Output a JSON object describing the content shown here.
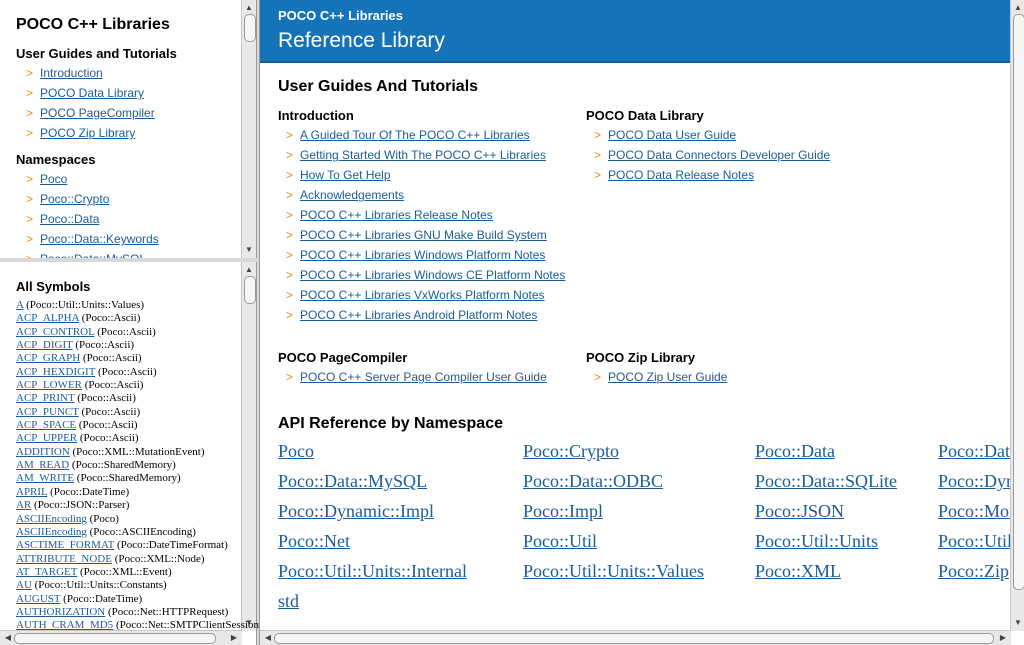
{
  "top_left": {
    "title": "POCO C++ Libraries",
    "guides_heading": "User Guides and Tutorials",
    "guides": [
      "Introduction",
      "POCO Data Library",
      "POCO PageCompiler",
      "POCO Zip Library"
    ],
    "namespaces_heading": "Namespaces",
    "namespaces": [
      "Poco",
      "Poco::Crypto",
      "Poco::Data",
      "Poco::Data::Keywords",
      "Poco::Data::MySQL"
    ]
  },
  "bottom_left": {
    "heading": "All Symbols",
    "symbols": [
      {
        "name": "A",
        "scope": "(Poco::Util::Units::Values)"
      },
      {
        "name": "ACP_ALPHA",
        "scope": "(Poco::Ascii)"
      },
      {
        "name": "ACP_CONTROL",
        "scope": "(Poco::Ascii)"
      },
      {
        "name": "ACP_DIGIT",
        "scope": "(Poco::Ascii)"
      },
      {
        "name": "ACP_GRAPH",
        "scope": "(Poco::Ascii)"
      },
      {
        "name": "ACP_HEXDIGIT",
        "scope": "(Poco::Ascii)"
      },
      {
        "name": "ACP_LOWER",
        "scope": "(Poco::Ascii)"
      },
      {
        "name": "ACP_PRINT",
        "scope": "(Poco::Ascii)"
      },
      {
        "name": "ACP_PUNCT",
        "scope": "(Poco::Ascii)"
      },
      {
        "name": "ACP_SPACE",
        "scope": "(Poco::Ascii)"
      },
      {
        "name": "ACP_UPPER",
        "scope": "(Poco::Ascii)"
      },
      {
        "name": "ADDITION",
        "scope": "(Poco::XML::MutationEvent)"
      },
      {
        "name": "AM_READ",
        "scope": "(Poco::SharedMemory)"
      },
      {
        "name": "AM_WRITE",
        "scope": "(Poco::SharedMemory)"
      },
      {
        "name": "APRIL",
        "scope": "(Poco::DateTime)"
      },
      {
        "name": "AR",
        "scope": "(Poco::JSON::Parser)"
      },
      {
        "name": "ASCIIEncoding",
        "scope": "(Poco)"
      },
      {
        "name": "ASCIIEncoding",
        "scope": "(Poco::ASCIIEncoding)"
      },
      {
        "name": "ASCTIME_FORMAT",
        "scope": "(Poco::DateTimeFormat)"
      },
      {
        "name": "ATTRIBUTE_NODE",
        "scope": "(Poco::XML::Node)"
      },
      {
        "name": "AT_TARGET",
        "scope": "(Poco::XML::Event)"
      },
      {
        "name": "AU",
        "scope": "(Poco::Util::Units::Constants)"
      },
      {
        "name": "AUGUST",
        "scope": "(Poco::DateTime)"
      },
      {
        "name": "AUTHORIZATION",
        "scope": "(Poco::Net::HTTPRequest)"
      },
      {
        "name": "AUTH_CRAM_MD5",
        "scope": "(Poco::Net::SMTPClientSession)"
      }
    ]
  },
  "main": {
    "banner_small": "POCO C++ Libraries",
    "banner_title": "Reference Library",
    "section_guides": "User Guides And Tutorials",
    "intro_heading": "Introduction",
    "intro_links": [
      "A Guided Tour Of The POCO C++ Libraries",
      "Getting Started With The POCO C++ Libraries",
      "How To Get Help",
      "Acknowledgements",
      "POCO C++ Libraries Release Notes",
      "POCO C++ Libraries GNU Make Build System",
      "POCO C++ Libraries Windows Platform Notes",
      "POCO C++ Libraries Windows CE Platform Notes",
      "POCO C++ Libraries VxWorks Platform Notes",
      "POCO C++ Libraries Android Platform Notes"
    ],
    "data_heading": "POCO Data Library",
    "data_links": [
      "POCO Data User Guide",
      "POCO Data Connectors Developer Guide",
      "POCO Data Release Notes"
    ],
    "pagecompiler_heading": "POCO PageCompiler",
    "pagecompiler_links": [
      "POCO C++ Server Page Compiler User Guide"
    ],
    "zip_heading": "POCO Zip Library",
    "zip_links": [
      "POCO Zip User Guide"
    ],
    "section_api": "API Reference by Namespace",
    "api_namespaces": [
      "Poco",
      "Poco::Crypto",
      "Poco::Data",
      "Poco::Data::Keywords",
      "Poco::Data::MySQL",
      "Poco::Data::ODBC",
      "Poco::Data::SQLite",
      "Poco::Dynamic",
      "Poco::Dynamic::Impl",
      "Poco::Impl",
      "Poco::JSON",
      "Poco::MongoDB",
      "Poco::Net",
      "Poco::Util",
      "Poco::Util::Units",
      "Poco::Util::Units::Constants",
      "Poco::Util::Units::Internal",
      "Poco::Util::Units::Values",
      "Poco::XML",
      "Poco::Zip",
      "std"
    ]
  }
}
